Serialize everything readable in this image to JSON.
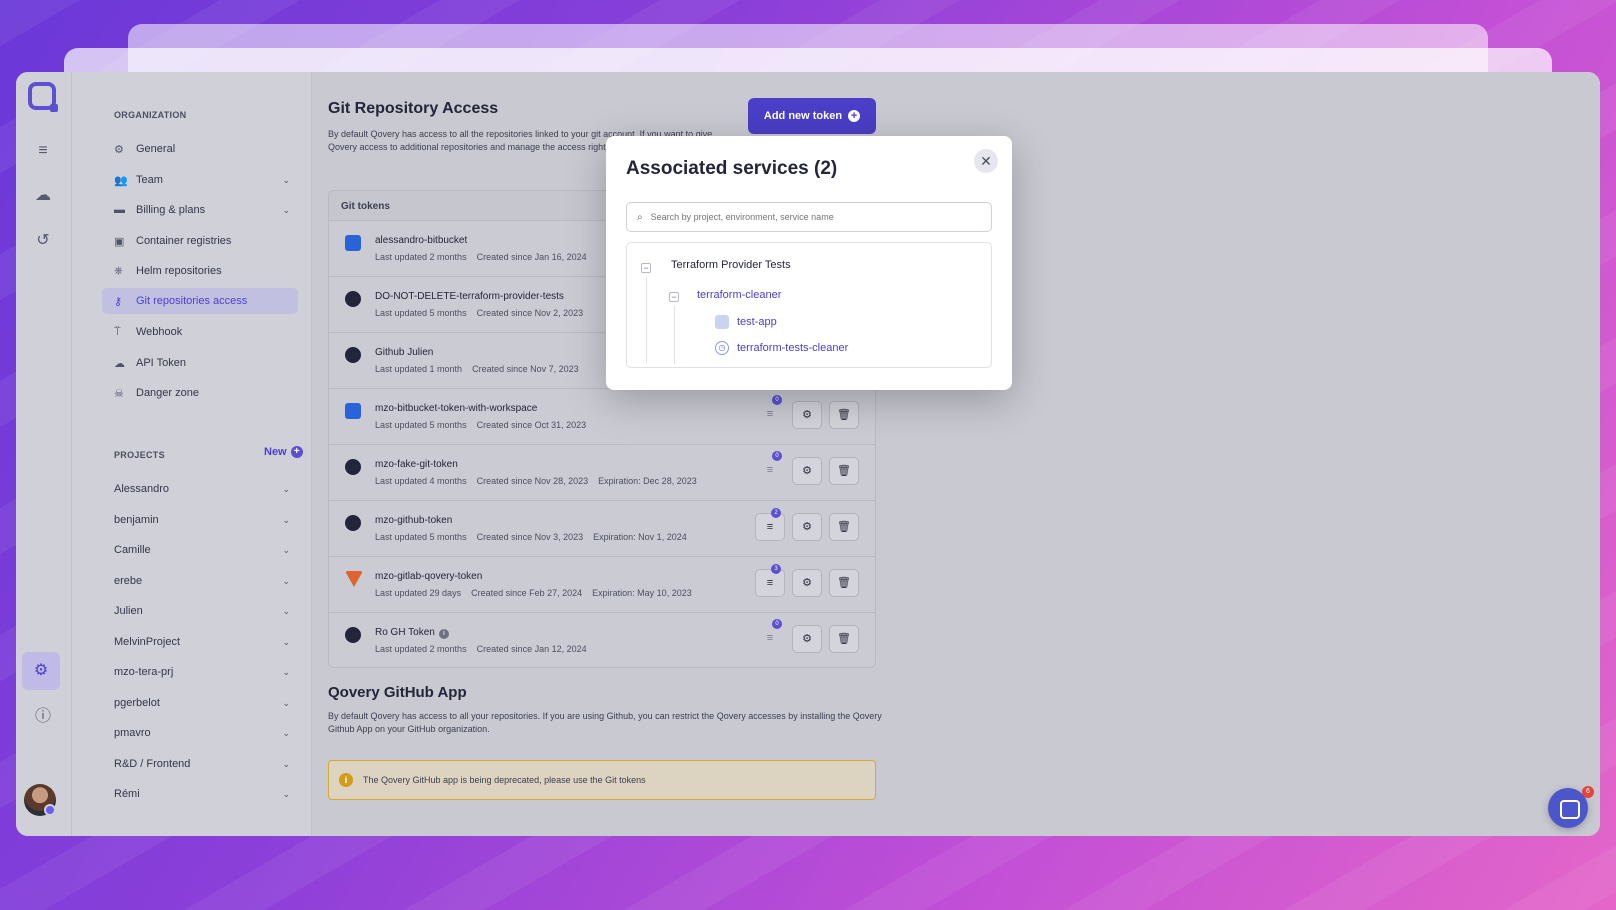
{
  "sidebar": {
    "organization_label": "ORGANIZATION",
    "items": [
      {
        "label": "General",
        "icon": "gear-icon"
      },
      {
        "label": "Team",
        "icon": "team-icon"
      },
      {
        "label": "Billing & plans",
        "icon": "card-icon"
      },
      {
        "label": "Container registries",
        "icon": "container-icon"
      },
      {
        "label": "Helm repositories",
        "icon": "helm-icon"
      },
      {
        "label": "Git repositories access",
        "icon": "key-icon",
        "active": true
      },
      {
        "label": "Webhook",
        "icon": "webhook-icon"
      },
      {
        "label": "API Token",
        "icon": "cloud-key-icon"
      },
      {
        "label": "Danger zone",
        "icon": "skull-icon"
      }
    ],
    "projects_label": "PROJECTS",
    "new_label": "New",
    "projects": [
      "Alessandro",
      "benjamin",
      "Camille",
      "erebe",
      "Julien",
      "MelvinProject",
      "mzo-tera-prj",
      "pgerbelot",
      "pmavro",
      "R&D / Frontend",
      "Rémi"
    ]
  },
  "main": {
    "title": "Git Repository Access",
    "description": "By default Qovery has access to all the repositories linked to your git account. If you want to give Qovery access to additional repositories and manage the access rights, you can configure a git token.",
    "add_button": "Add new token",
    "tokens_header": "Git tokens",
    "tokens": [
      {
        "name": "alessandro-bitbucket",
        "provider": "bitbucket",
        "updated": "Last updated 2 months",
        "created": "Created since Jan 16, 2024",
        "expiration": ""
      },
      {
        "name": "DO-NOT-DELETE-terraform-provider-tests",
        "provider": "github",
        "updated": "Last updated 5 months",
        "created": "Created since Nov 2, 2023",
        "expiration": ""
      },
      {
        "name": "Github Julien",
        "provider": "github",
        "updated": "Last updated 1 month",
        "created": "Created since Nov 7, 2023",
        "expiration": ""
      },
      {
        "name": "mzo-bitbucket-token-with-workspace",
        "provider": "bitbucket",
        "updated": "Last updated 5 months",
        "created": "Created since Oct 31, 2023",
        "expiration": "",
        "services": "0"
      },
      {
        "name": "mzo-fake-git-token",
        "provider": "github",
        "updated": "Last updated 4 months",
        "created": "Created since Nov 28, 2023",
        "expiration": "Expiration: Dec 28, 2023",
        "services": "0"
      },
      {
        "name": "mzo-github-token",
        "provider": "github",
        "updated": "Last updated 5 months",
        "created": "Created since Nov 3, 2023",
        "expiration": "Expiration: Nov 1, 2024",
        "services": "2"
      },
      {
        "name": "mzo-gitlab-qovery-token",
        "provider": "gitlab",
        "updated": "Last updated 29 days",
        "created": "Created since Feb 27, 2024",
        "expiration": "Expiration: May 10, 2023",
        "services": "3"
      },
      {
        "name": "Ro GH Token",
        "provider": "github",
        "updated": "Last updated 2 months",
        "created": "Created since Jan 12, 2024",
        "expiration": "",
        "services": "0"
      }
    ],
    "app_title": "Qovery GitHub App",
    "app_description": "By default Qovery has access to all your repositories. If you are using Github, you can restrict the Qovery accesses by installing the Qovery Github App on your GitHub organization.",
    "warning": "The Qovery GitHub app is being deprecated, please use the Git tokens"
  },
  "modal": {
    "title": "Associated services (2)",
    "search_placeholder": "Search by project, environment, service name",
    "project": "Terraform Provider Tests",
    "environment": "terraform-cleaner",
    "services": [
      "test-app",
      "terraform-tests-cleaner"
    ]
  },
  "chat_badge": "6"
}
